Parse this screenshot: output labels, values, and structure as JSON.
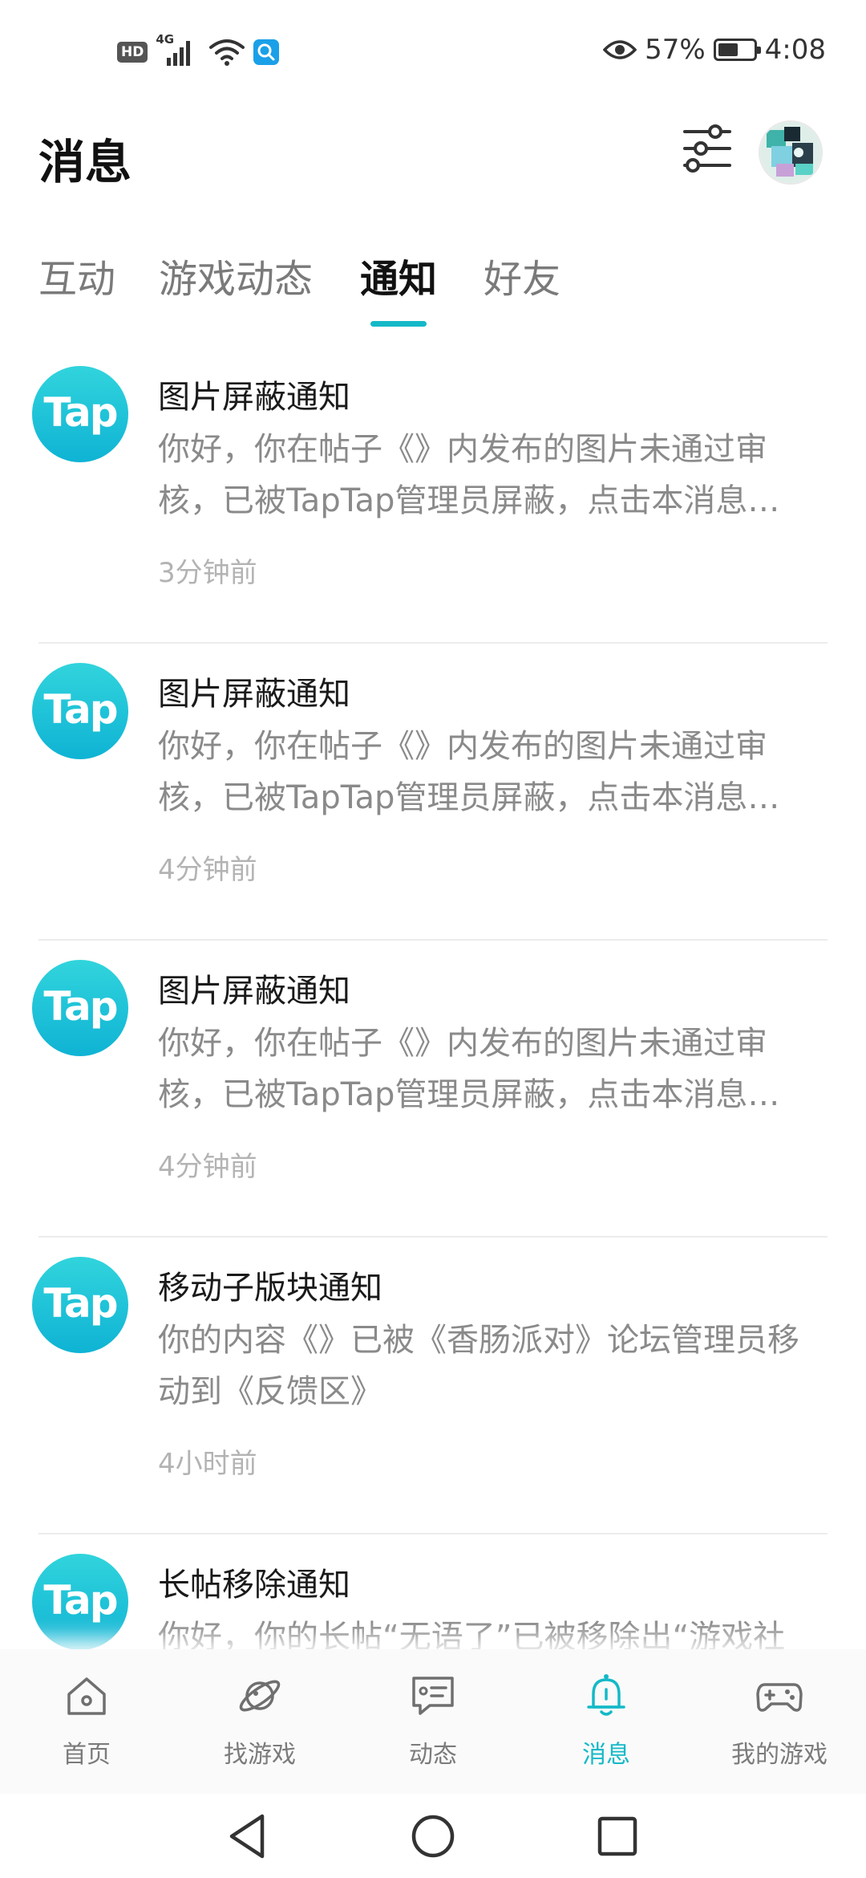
{
  "status_bar": {
    "hd_badge": "HD",
    "network": "4G",
    "battery_percent": "57%",
    "battery_level": 0.57,
    "time": "4:08",
    "icons": [
      "hd-icon",
      "signal-icon",
      "wifi-icon",
      "app-notification-icon",
      "eye-icon",
      "battery-icon"
    ]
  },
  "header": {
    "title": "消息",
    "filter_icon": "filter-sliders-icon",
    "avatar_icon": "user-avatar"
  },
  "tabs": [
    {
      "label": "互动",
      "active": false
    },
    {
      "label": "游戏动态",
      "active": false
    },
    {
      "label": "通知",
      "active": true
    },
    {
      "label": "好友",
      "active": false
    }
  ],
  "notifications": [
    {
      "logo_text": "Tap",
      "title": "图片屏蔽通知",
      "body": "你好，你在帖子《》内发布的图片未通过审核，已被TapTap管理员屏蔽，点击本消息…",
      "time": "3分钟前"
    },
    {
      "logo_text": "Tap",
      "title": "图片屏蔽通知",
      "body": "你好，你在帖子《》内发布的图片未通过审核，已被TapTap管理员屏蔽，点击本消息…",
      "time": "4分钟前"
    },
    {
      "logo_text": "Tap",
      "title": "图片屏蔽通知",
      "body": "你好，你在帖子《》内发布的图片未通过审核，已被TapTap管理员屏蔽，点击本消息…",
      "time": "4分钟前"
    },
    {
      "logo_text": "Tap",
      "title": "移动子版块通知",
      "body": "你的内容《》已被《香肠派对》论坛管理员移动到《反馈区》",
      "time": "4小时前"
    },
    {
      "logo_text": "Tap",
      "title": "长帖移除通知",
      "body": "你好，你的长帖“无语了”已被移除出“游戏社",
      "time": ""
    }
  ],
  "bottom_nav": [
    {
      "label": "首页",
      "icon": "home-icon",
      "active": false
    },
    {
      "label": "找游戏",
      "icon": "planet-icon",
      "active": false
    },
    {
      "label": "动态",
      "icon": "chat-card-icon",
      "active": false
    },
    {
      "label": "消息",
      "icon": "bell-icon",
      "active": true
    },
    {
      "label": "我的游戏",
      "icon": "gamepad-icon",
      "active": false
    }
  ],
  "system_nav": [
    "back-icon",
    "home-circle-icon",
    "recents-icon"
  ],
  "colors": {
    "accent": "#14b9c8",
    "tap_logo_top": "#31d4dc",
    "tap_logo_bottom": "#0fb3d4",
    "text_primary": "#1a1a1a",
    "text_secondary": "#8a8a8a",
    "text_muted": "#b3b3b3"
  }
}
